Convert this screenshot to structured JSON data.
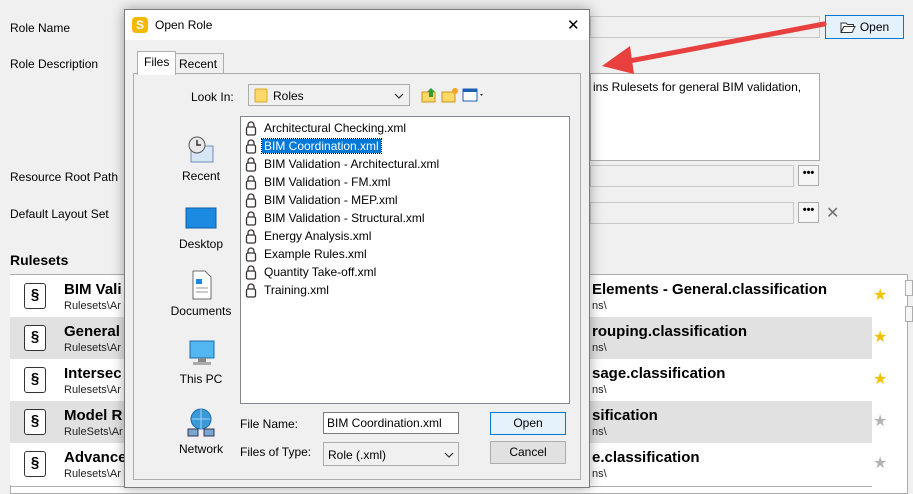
{
  "form": {
    "role_name_label": "Role Name",
    "role_description_label": "Role Description",
    "description_text": "ins Rulesets for general BIM validation,",
    "resource_root_label": "Resource Root Path",
    "default_layout_label": "Default Layout Set",
    "rulesets_heading": "Rulesets",
    "open_button_label": "Open",
    "browse_glyph": "•••",
    "clear_glyph": "✕"
  },
  "rulesets_left": [
    {
      "title": "BIM Vali",
      "path": "Rulesets\\Ar"
    },
    {
      "title": "General",
      "path": "Rulesets\\Ar"
    },
    {
      "title": "Intersec",
      "path": "Rulesets\\Ar"
    },
    {
      "title": "Model R",
      "path": "RuleSets\\Ar"
    },
    {
      "title": "Advance",
      "path": "Rulesets\\Ar"
    }
  ],
  "rulesets_right": [
    {
      "title": "Elements - General.classification",
      "path": "ns\\",
      "starred": true
    },
    {
      "title": "rouping.classification",
      "path": "ns\\",
      "starred": true
    },
    {
      "title": "sage.classification",
      "path": "ns\\",
      "starred": true
    },
    {
      "title": "sification",
      "path": "ns\\",
      "starred": false
    },
    {
      "title": "e.classification",
      "path": "ns\\",
      "starred": false
    }
  ],
  "ruleset_icon_glyph": "§",
  "star_glyph": "★",
  "colors": {
    "star_on": "#f2c200",
    "star_off": "#b4b4b4",
    "row_alt": "#e1e1e1",
    "selection": "#0078d7",
    "arrow": "#e8403f"
  },
  "dialog": {
    "app_icon_letter": "S",
    "title": "Open Role",
    "close_glyph": "✕",
    "tabs": [
      {
        "label": "Files"
      },
      {
        "label": "Recent"
      }
    ],
    "look_in_label": "Look In:",
    "look_in_value": "Roles",
    "places": [
      {
        "label": "Recent",
        "icon": "recent-icon"
      },
      {
        "label": "Desktop",
        "icon": "desktop-icon"
      },
      {
        "label": "Documents",
        "icon": "documents-icon"
      },
      {
        "label": "This PC",
        "icon": "this-pc-icon"
      },
      {
        "label": "Network",
        "icon": "network-icon"
      }
    ],
    "files": [
      {
        "name": "Architectural Checking.xml"
      },
      {
        "name": "BIM Coordination.xml",
        "selected": true
      },
      {
        "name": "BIM Validation - Architectural.xml"
      },
      {
        "name": "BIM Validation - FM.xml"
      },
      {
        "name": "BIM Validation - MEP.xml"
      },
      {
        "name": "BIM Validation - Structural.xml"
      },
      {
        "name": "Energy Analysis.xml"
      },
      {
        "name": "Example Rules.xml"
      },
      {
        "name": "Quantity Take-off.xml"
      },
      {
        "name": "Training.xml"
      }
    ],
    "file_name_label": "File Name:",
    "file_name_value": "BIM Coordination.xml",
    "files_of_type_label": "Files of Type:",
    "files_of_type_value": "Role (.xml)",
    "open_label": "Open",
    "cancel_label": "Cancel"
  }
}
